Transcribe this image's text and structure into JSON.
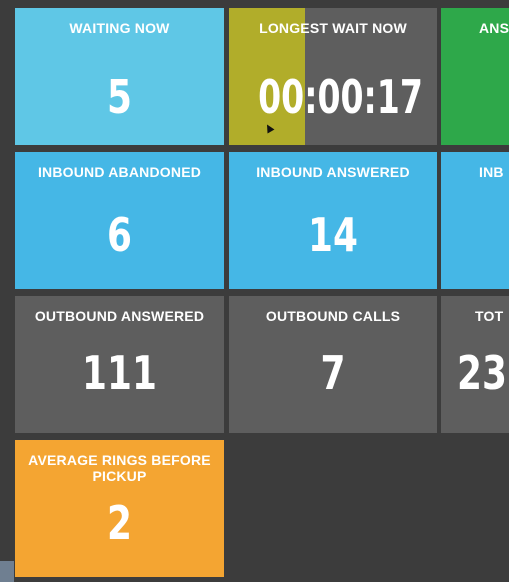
{
  "colors": {
    "light_blue": "#5fc7e6",
    "blue": "#45b7e6",
    "gray": "#5e5e5e",
    "green": "#2ea84a",
    "orange": "#f4a532",
    "olive_highlight": "#b1ad2a",
    "background": "#3c3c3c"
  },
  "tiles": {
    "waiting_now": {
      "label": "WAITING NOW",
      "value": "5"
    },
    "longest_wait_now": {
      "label": "LONGEST WAIT NOW",
      "value": "00:00:17"
    },
    "answered_cut": {
      "label": "ANS",
      "value": ""
    },
    "inbound_abandoned": {
      "label": "INBOUND ABANDONED",
      "value": "6"
    },
    "inbound_answered": {
      "label": "INBOUND ANSWERED",
      "value": "14"
    },
    "inbound_cut": {
      "label": "INB",
      "value": ""
    },
    "outbound_answered": {
      "label": "OUTBOUND ANSWERED",
      "value": "111"
    },
    "outbound_calls": {
      "label": "OUTBOUND CALLS",
      "value": "7"
    },
    "total_cut": {
      "label": "TOT",
      "value": "23"
    },
    "avg_rings": {
      "label": "AVERAGE RINGS BEFORE PICKUP",
      "value": "2"
    }
  }
}
